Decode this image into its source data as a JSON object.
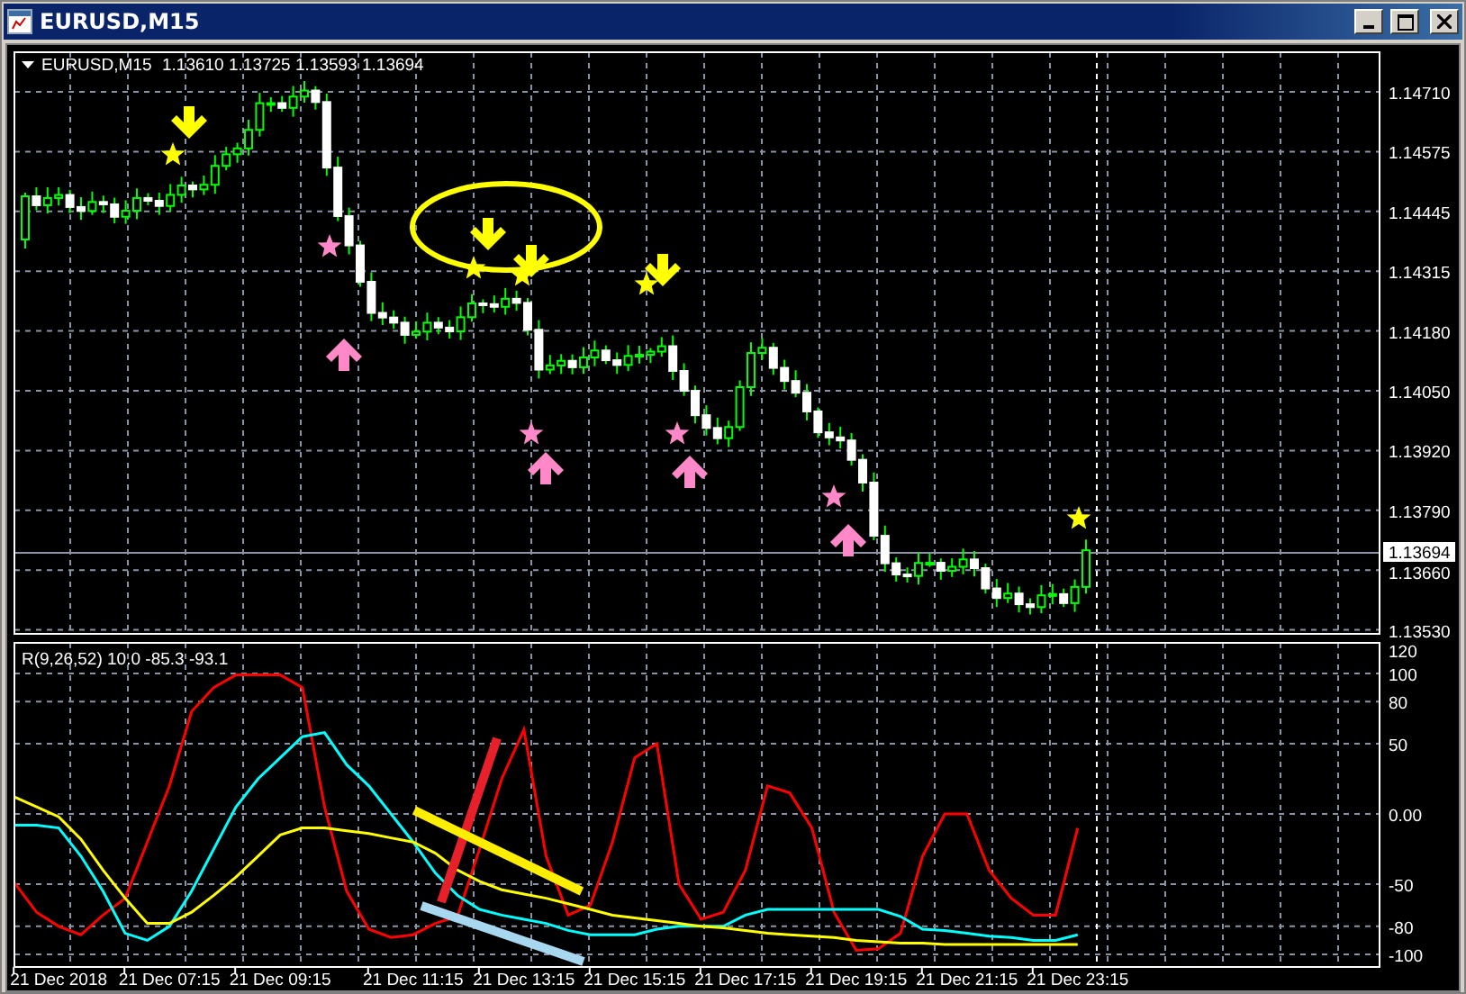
{
  "window": {
    "title": "EURUSD,M15"
  },
  "price_chart": {
    "symbol": "EURUSD,M15",
    "ohlc": [
      "1.13610",
      "1.13725",
      "1.13593",
      "1.13694"
    ],
    "price_labels": [
      "1.14710",
      "1.14575",
      "1.14445",
      "1.14315",
      "1.14180",
      "1.14050",
      "1.13920",
      "1.13790",
      "1.13660",
      "1.13530"
    ],
    "current_price": "1.13694"
  },
  "indicator": {
    "label": "R(9,26,52) 10.0 -85.3 -93.1",
    "chart_data": {
      "type": "line",
      "categories": [
        null,
        null,
        "21 Dec 2018",
        null,
        null,
        null,
        null,
        "21 Dec 07:15",
        null,
        null,
        null,
        null,
        "21 Dec 09:15",
        null,
        null,
        null,
        null,
        null,
        "21 Dec 11:15",
        null,
        null,
        null,
        null,
        "21 Dec 13:15",
        null,
        null,
        null,
        null,
        "21 Dec 15:15",
        null,
        null,
        null,
        null,
        "21 Dec 17:15",
        null,
        null,
        null,
        null,
        "21 Dec 19:15",
        null,
        null,
        null,
        null,
        "21 Dec 21:15",
        null,
        null,
        null,
        null,
        "21 Dec 23:15"
      ],
      "series": [
        {
          "color": "#ff0000",
          "values": [
            -49,
            -70,
            -80,
            -86,
            -72,
            -60,
            -20,
            20,
            73,
            90,
            99,
            99,
            99,
            90,
            5,
            -55,
            -82,
            -88,
            -86,
            -78,
            -73,
            -25,
            25,
            60,
            -30,
            -72,
            -65,
            -20,
            40,
            50,
            -50,
            -75,
            -70,
            -40,
            20,
            15,
            -10,
            -70,
            -97,
            -96,
            -85,
            -30,
            0,
            0,
            -40,
            -60,
            -72,
            -72,
            -10
          ]
        },
        {
          "color": "#00ffff",
          "values": [
            -8,
            -8,
            -10,
            -30,
            -55,
            -85,
            -90,
            -80,
            -55,
            -25,
            5,
            25,
            40,
            55,
            58,
            35,
            20,
            0,
            -20,
            -42,
            -58,
            -68,
            -72,
            -75,
            -78,
            -83,
            -86,
            -86,
            -86,
            -82,
            -80,
            -80,
            -80,
            -72,
            -68,
            -68,
            -68,
            -68,
            -68,
            -68,
            -73,
            -82,
            -83,
            -85,
            -87,
            -88,
            -90,
            -90,
            -86
          ]
        },
        {
          "color": "#ffff00",
          "values": [
            12,
            5,
            -2,
            -18,
            -40,
            -60,
            -78,
            -78,
            -70,
            -58,
            -45,
            -30,
            -15,
            -10,
            -10,
            -12,
            -14,
            -17,
            -20,
            -28,
            -40,
            -48,
            -54,
            -57,
            -60,
            -64,
            -68,
            -72,
            -74,
            -76,
            -78,
            -80,
            -81,
            -83,
            -85,
            -86,
            -87,
            -88,
            -90,
            -91,
            -92,
            -92,
            -93,
            -93,
            -93,
            -93,
            -93,
            -93,
            -93
          ]
        }
      ],
      "grid": true,
      "ylim": [
        -100,
        120
      ],
      "yticks": [
        {
          "value": 120,
          "label": "120"
        },
        {
          "value": 100,
          "label": "100"
        },
        {
          "value": 80,
          "label": "80"
        },
        {
          "value": 50,
          "label": "50"
        },
        {
          "value": 0,
          "label": "0.00"
        },
        {
          "value": -50,
          "label": "-50"
        },
        {
          "value": -80,
          "label": "-80"
        },
        {
          "value": -100,
          "label": "-100"
        }
      ]
    }
  }
}
